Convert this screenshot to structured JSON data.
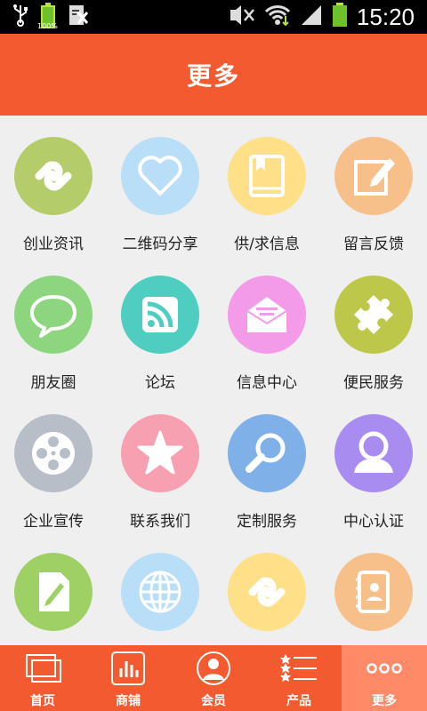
{
  "status_bar": {
    "battery_text": "100%",
    "time": "15:20"
  },
  "header": {
    "title": "更多"
  },
  "grid": {
    "items": [
      {
        "label": "创业资讯",
        "icon": "link-icon",
        "color": "#b5cc6a"
      },
      {
        "label": "二维码分享",
        "icon": "heart-icon",
        "color": "#b9def7"
      },
      {
        "label": "供/求信息",
        "icon": "book-icon",
        "color": "#fde087"
      },
      {
        "label": "留言反馈",
        "icon": "edit-icon",
        "color": "#f7c08a"
      },
      {
        "label": "朋友圈",
        "icon": "chat-bubble-icon",
        "color": "#8dd67f"
      },
      {
        "label": "论坛",
        "icon": "rss-icon",
        "color": "#4ecdc0"
      },
      {
        "label": "信息中心",
        "icon": "envelope-icon",
        "color": "#f39ae9"
      },
      {
        "label": "便民服务",
        "icon": "puzzle-icon",
        "color": "#bdc84a"
      },
      {
        "label": "企业宣传",
        "icon": "film-reel-icon",
        "color": "#b8bec7"
      },
      {
        "label": "联系我们",
        "icon": "star-icon",
        "color": "#f7a0b1"
      },
      {
        "label": "定制服务",
        "icon": "magnifier-icon",
        "color": "#7fb1e8"
      },
      {
        "label": "中心认证",
        "icon": "user-icon",
        "color": "#a98cf0"
      },
      {
        "label": "",
        "icon": "document-edit-icon",
        "color": "#9fd066"
      },
      {
        "label": "",
        "icon": "globe-icon",
        "color": "#b9def7"
      },
      {
        "label": "",
        "icon": "link-icon",
        "color": "#fde087"
      },
      {
        "label": "",
        "icon": "contact-book-icon",
        "color": "#f7c08a"
      }
    ]
  },
  "bottom_nav": {
    "items": [
      {
        "label": "首页",
        "icon": "home-icon"
      },
      {
        "label": "商铺",
        "icon": "shop-icon"
      },
      {
        "label": "会员",
        "icon": "member-icon"
      },
      {
        "label": "产品",
        "icon": "product-list-icon"
      },
      {
        "label": "更多",
        "icon": "more-icon",
        "active": true
      }
    ]
  },
  "colors": {
    "accent": "#f35a2f",
    "active_tab": "#ff8a68"
  }
}
